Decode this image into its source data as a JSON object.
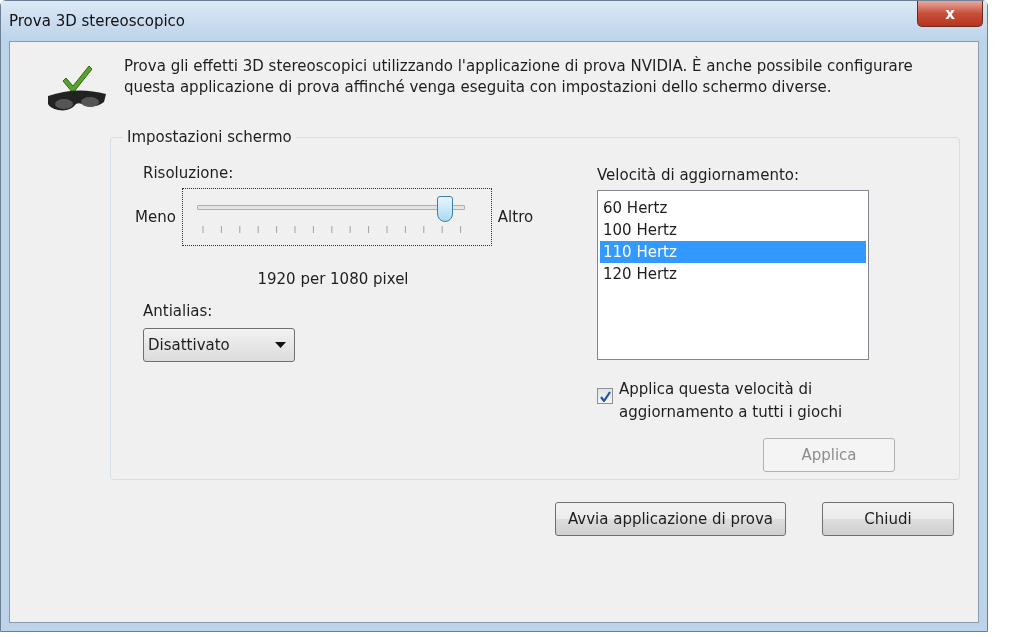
{
  "window": {
    "title": "Prova 3D stereoscopico",
    "close_label": "x"
  },
  "description": "Prova gli effetti 3D stereoscopici utilizzando l'applicazione di prova NVIDIA. È anche possibile configurare questa applicazione di prova affinché venga eseguita con impostazioni dello schermo diverse.",
  "group": {
    "title": "Impostazioni schermo",
    "resolution": {
      "label": "Risoluzione:",
      "min_label": "Meno",
      "max_label": "Altro",
      "level": 0.93,
      "reading": "1920 per 1080 pixel"
    },
    "antialias": {
      "label": "Antialias:",
      "value": "Disattivato"
    },
    "refresh": {
      "label": "Velocità di aggiornamento:",
      "items": [
        {
          "label": "60 Hertz",
          "selected": false
        },
        {
          "label": "100 Hertz",
          "selected": false
        },
        {
          "label": "110 Hertz",
          "selected": true
        },
        {
          "label": "120 Hertz",
          "selected": false
        }
      ]
    },
    "apply_all": {
      "label": "Applica questa velocità di aggiornamento a tutti i giochi",
      "checked": true
    },
    "apply_button": {
      "label": "Applica",
      "disabled": true
    }
  },
  "buttons": [
    "Avvia applicazione di prova",
    "Chiudi"
  ]
}
